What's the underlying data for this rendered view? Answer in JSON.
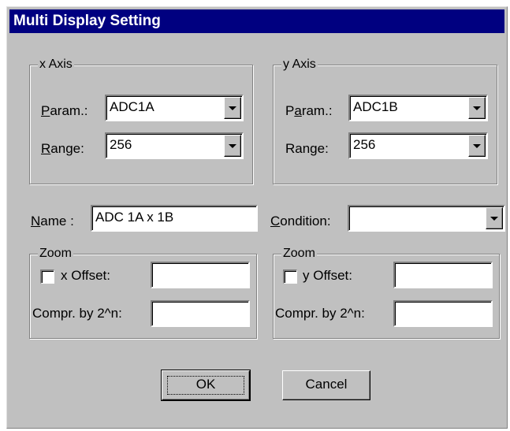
{
  "dialog": {
    "title": "Multi Display Setting"
  },
  "x_axis": {
    "group_label": "x Axis",
    "param_label": {
      "mnemonic": "P",
      "rest": "aram.:"
    },
    "param_value": "ADC1A",
    "range_label": {
      "mnemonic": "R",
      "rest": "ange:"
    },
    "range_value": "256"
  },
  "y_axis": {
    "group_label": "y Axis",
    "param_label": {
      "pre": "P",
      "mnemonic": "a",
      "rest": "ram.:"
    },
    "param_value": "ADC1B",
    "range_label": "Range:",
    "range_value": "256"
  },
  "name": {
    "label_mnemonic": "N",
    "label_rest": "ame :",
    "value": "ADC 1A x 1B"
  },
  "condition": {
    "label_mnemonic": "C",
    "label_rest": "ondition:",
    "value": ""
  },
  "zoom_x": {
    "group_label": "Zoom",
    "offset_label": "x Offset:",
    "offset_checked": false,
    "offset_value": "",
    "compr_label": "Compr. by 2^n:",
    "compr_value": ""
  },
  "zoom_y": {
    "group_label": "Zoom",
    "offset_label": "y Offset:",
    "offset_checked": false,
    "offset_value": "",
    "compr_label": "Compr. by 2^n:",
    "compr_value": ""
  },
  "buttons": {
    "ok": "OK",
    "cancel": "Cancel"
  },
  "icons": {
    "dropdown": "chevron-down-icon"
  },
  "colors": {
    "titlebar": "#000080",
    "face": "#c0c0c0"
  }
}
